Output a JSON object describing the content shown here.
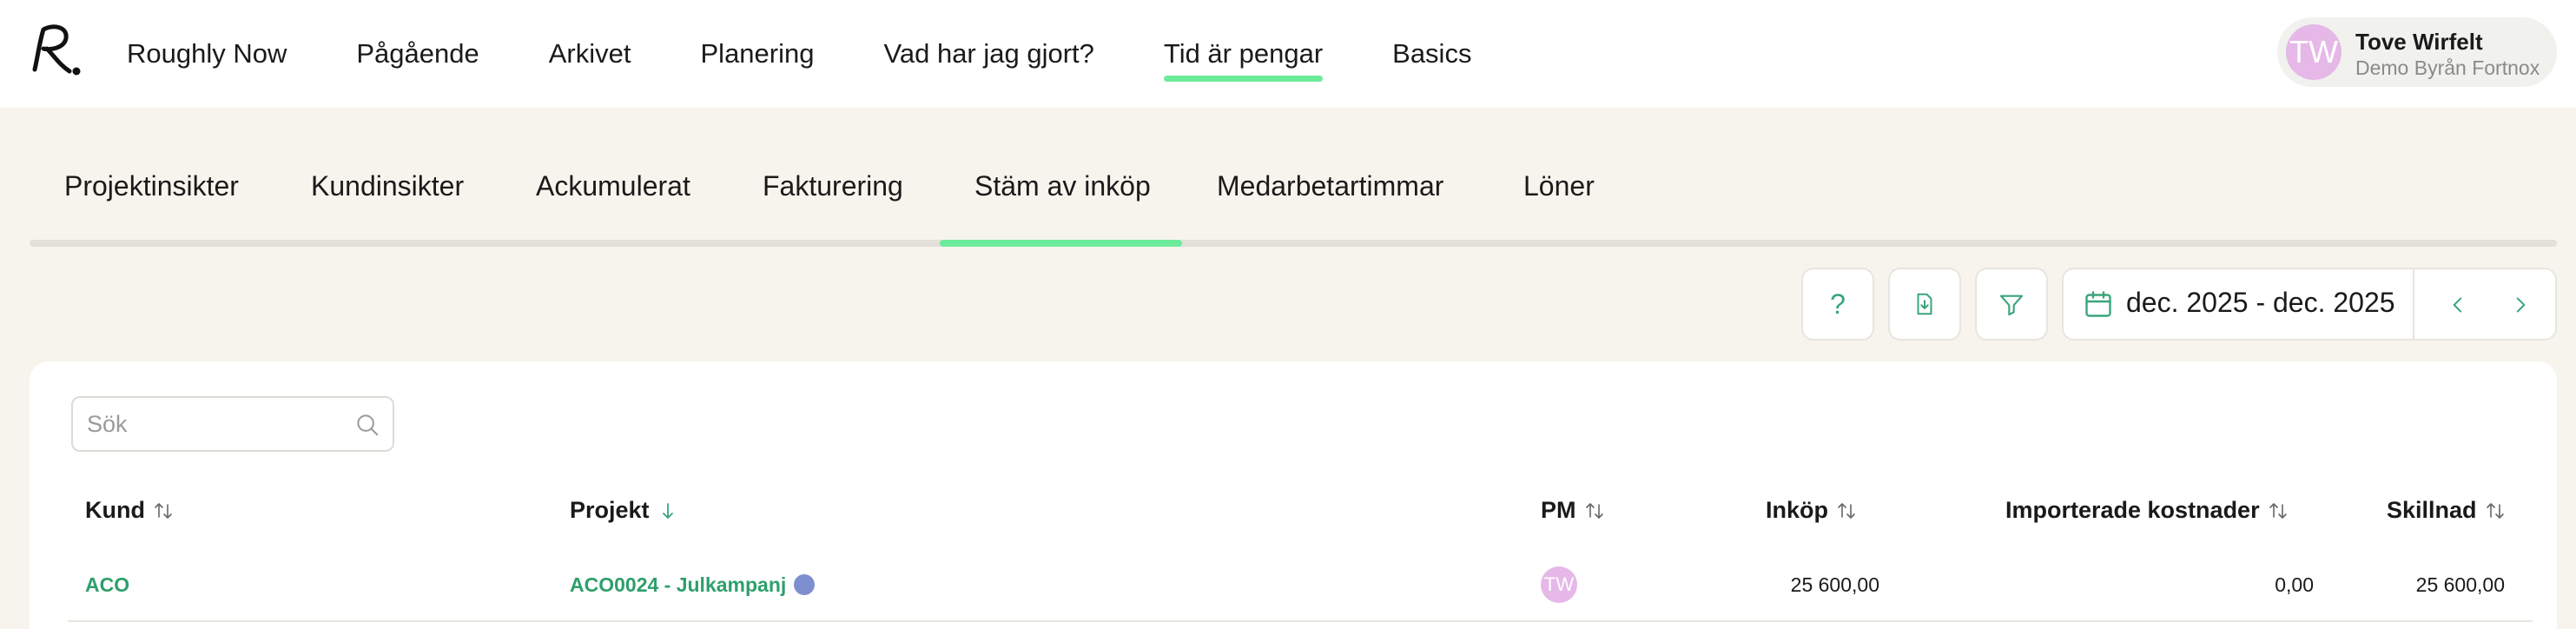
{
  "app": {
    "logo_text": "R."
  },
  "nav": {
    "items": [
      {
        "label": "Roughly Now"
      },
      {
        "label": "Pågående"
      },
      {
        "label": "Arkivet"
      },
      {
        "label": "Planering"
      },
      {
        "label": "Vad har jag gjort?"
      },
      {
        "label": "Tid är pengar",
        "active": true
      },
      {
        "label": "Basics"
      }
    ]
  },
  "user": {
    "initials": "TW",
    "name": "Tove Wirfelt",
    "org": "Demo Byrån Fortnox"
  },
  "subtabs": {
    "items": [
      {
        "label": "Projektinsikter"
      },
      {
        "label": "Kundinsikter"
      },
      {
        "label": "Ackumulerat"
      },
      {
        "label": "Fakturering"
      },
      {
        "label": "Stäm av inköp",
        "active": true
      },
      {
        "label": "Medarbetartimmar"
      },
      {
        "label": "Löner"
      }
    ]
  },
  "toolbar": {
    "help_label": "?",
    "date_range": "dec. 2025 - dec. 2025",
    "icons": [
      "help-icon",
      "export-icon",
      "filter-icon",
      "calendar-icon",
      "chevron-left-icon",
      "chevron-right-icon"
    ]
  },
  "search": {
    "placeholder": "Sök"
  },
  "table": {
    "columns": [
      {
        "label": "Kund",
        "sort": "both"
      },
      {
        "label": "Projekt",
        "sort": "desc"
      },
      {
        "label": "PM",
        "sort": "both"
      },
      {
        "label": "Inköp",
        "sort": "both"
      },
      {
        "label": "Importerade kostnader",
        "sort": "both"
      },
      {
        "label": "Skillnad",
        "sort": "both"
      }
    ],
    "rows": [
      {
        "kund": "ACO",
        "projekt": "ACO0024 - Julkampanj",
        "pm": "TW",
        "inkop": "25 600,00",
        "importerade": "0,00",
        "skillnad": "25 600,00"
      }
    ]
  },
  "colors": {
    "accent": "#6cec9b",
    "link": "#2e9f6b",
    "background": "#f6f4ec",
    "avatar": "#e5b8e7",
    "project_dot": "#7e8fd0"
  }
}
